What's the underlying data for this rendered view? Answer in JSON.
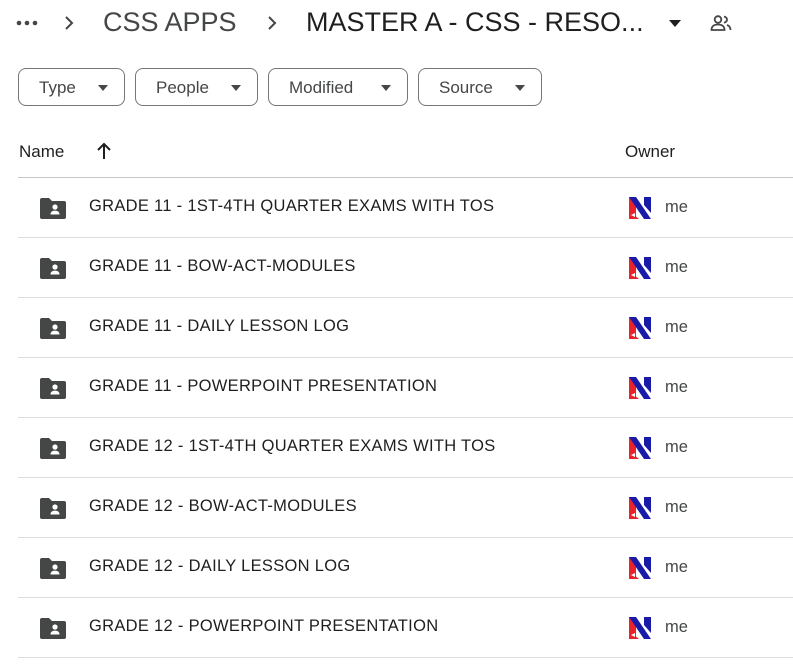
{
  "breadcrumb": {
    "more_icon": "more-horiz-icon",
    "items": [
      "CSS APPS",
      "MASTER A - CSS - RESO..."
    ],
    "separator_icon": "chevron-right-icon",
    "dropdown_icon": "arrow-drop-down-icon",
    "share_icon": "shared-people-icon"
  },
  "filters": [
    {
      "label": "Type"
    },
    {
      "label": "People"
    },
    {
      "label": "Modified"
    },
    {
      "label": "Source"
    }
  ],
  "table": {
    "name_header": "Name",
    "sort_icon": "arrow-upward-icon",
    "owner_header": "Owner",
    "rows": [
      {
        "name": "GRADE 11 - 1ST-4TH QUARTER EXAMS WITH TOS",
        "owner": "me"
      },
      {
        "name": "GRADE 11 - BOW-ACT-MODULES",
        "owner": "me"
      },
      {
        "name": "GRADE 11 - DAILY LESSON LOG",
        "owner": "me"
      },
      {
        "name": "GRADE 11 - POWERPOINT PRESENTATION",
        "owner": "me"
      },
      {
        "name": "GRADE 12 - 1ST-4TH QUARTER EXAMS WITH TOS",
        "owner": "me"
      },
      {
        "name": "GRADE 12 - BOW-ACT-MODULES",
        "owner": "me"
      },
      {
        "name": "GRADE 12 - DAILY LESSON LOG",
        "owner": "me"
      },
      {
        "name": "GRADE 12 - POWERPOINT PRESENTATION",
        "owner": "me"
      }
    ]
  },
  "colors": {
    "icon_gray": "#444746",
    "avatar_blue": "#1a1aa8",
    "avatar_red": "#e8232b"
  }
}
